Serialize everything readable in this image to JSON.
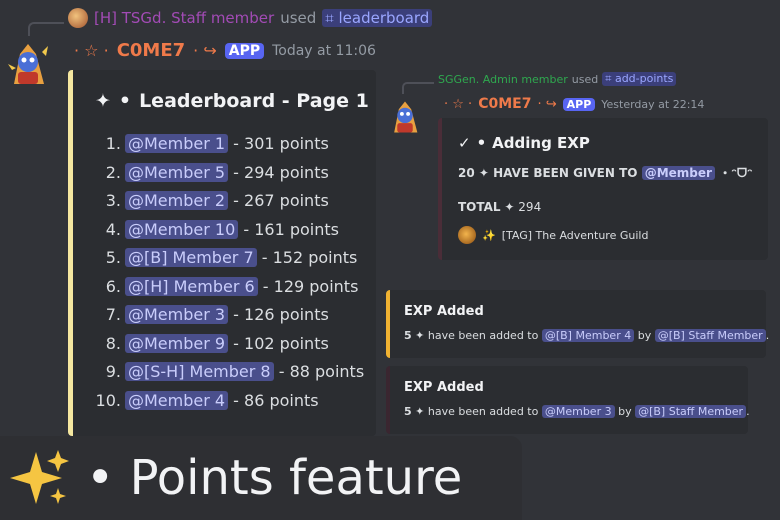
{
  "reply": {
    "user": "[H] TSGd. Staff member",
    "used": "used",
    "command": "leaderboard"
  },
  "message": {
    "username": "C0ME7",
    "badge": "APP",
    "timestamp": "Today at 11:06"
  },
  "leaderboard": {
    "title": "Leaderboard - Page 1",
    "entries": [
      {
        "rank": "1.",
        "member": "@Member 1",
        "points": "- 301 points"
      },
      {
        "rank": "2.",
        "member": "@Member 5",
        "points": "- 294 points"
      },
      {
        "rank": "3.",
        "member": "@Member 2",
        "points": "- 267 points"
      },
      {
        "rank": "4.",
        "member": "@Member 10",
        "points": "- 161 points"
      },
      {
        "rank": "5.",
        "member": "@[B] Member 7",
        "points": "- 152 points"
      },
      {
        "rank": "6.",
        "member": "@[H] Member 6",
        "points": "- 129 points"
      },
      {
        "rank": "7.",
        "member": "@Member 3",
        "points": "- 126 points"
      },
      {
        "rank": "8.",
        "member": "@Member 9",
        "points": "- 102 points"
      },
      {
        "rank": "9.",
        "member": "@[S-H] Member 8",
        "points": "- 88 points"
      },
      {
        "rank": "10.",
        "member": "@Member 4",
        "points": "- 86 points"
      }
    ]
  },
  "right_reply": {
    "user": "SGGen. Admin member",
    "used": "used",
    "command": "add-points"
  },
  "right_message": {
    "username": "C0ME7",
    "badge": "APP",
    "timestamp": "Yesterday at 22:14"
  },
  "exp_embed": {
    "title": "Adding EXP",
    "amount": "20",
    "given_text": "HAVE BEEN GIVEN TO",
    "member": "@Member",
    "kaomoji": "・ᵔᗜᵔ",
    "total_label": "TOTAL",
    "total_value": "294",
    "footer": "[TAG] The Adventure Guild"
  },
  "exp_cards": [
    {
      "title": "EXP Added",
      "amount": "5",
      "text": "have been added to",
      "member": "@[B] Member 4",
      "by": "by",
      "staff": "@[B] Staff Member",
      "end": "."
    },
    {
      "title": "EXP Added",
      "amount": "5",
      "text": "have been added to",
      "member": "@Member 3",
      "by": "by",
      "staff": "@[B] Staff Member",
      "end": "."
    }
  ],
  "caption": {
    "text": "• Points feature"
  },
  "colors": {
    "background": "#313338",
    "embed": "#2b2d31",
    "leaderboard_accent": "#f5e7a0",
    "exp_added_accent": "#f0b232",
    "mention": "#4a4f8c",
    "app_badge": "#5865f2",
    "username": "#ef7a4a",
    "staff_user": "#a24bb5",
    "admin_user": "#2fa84f"
  }
}
